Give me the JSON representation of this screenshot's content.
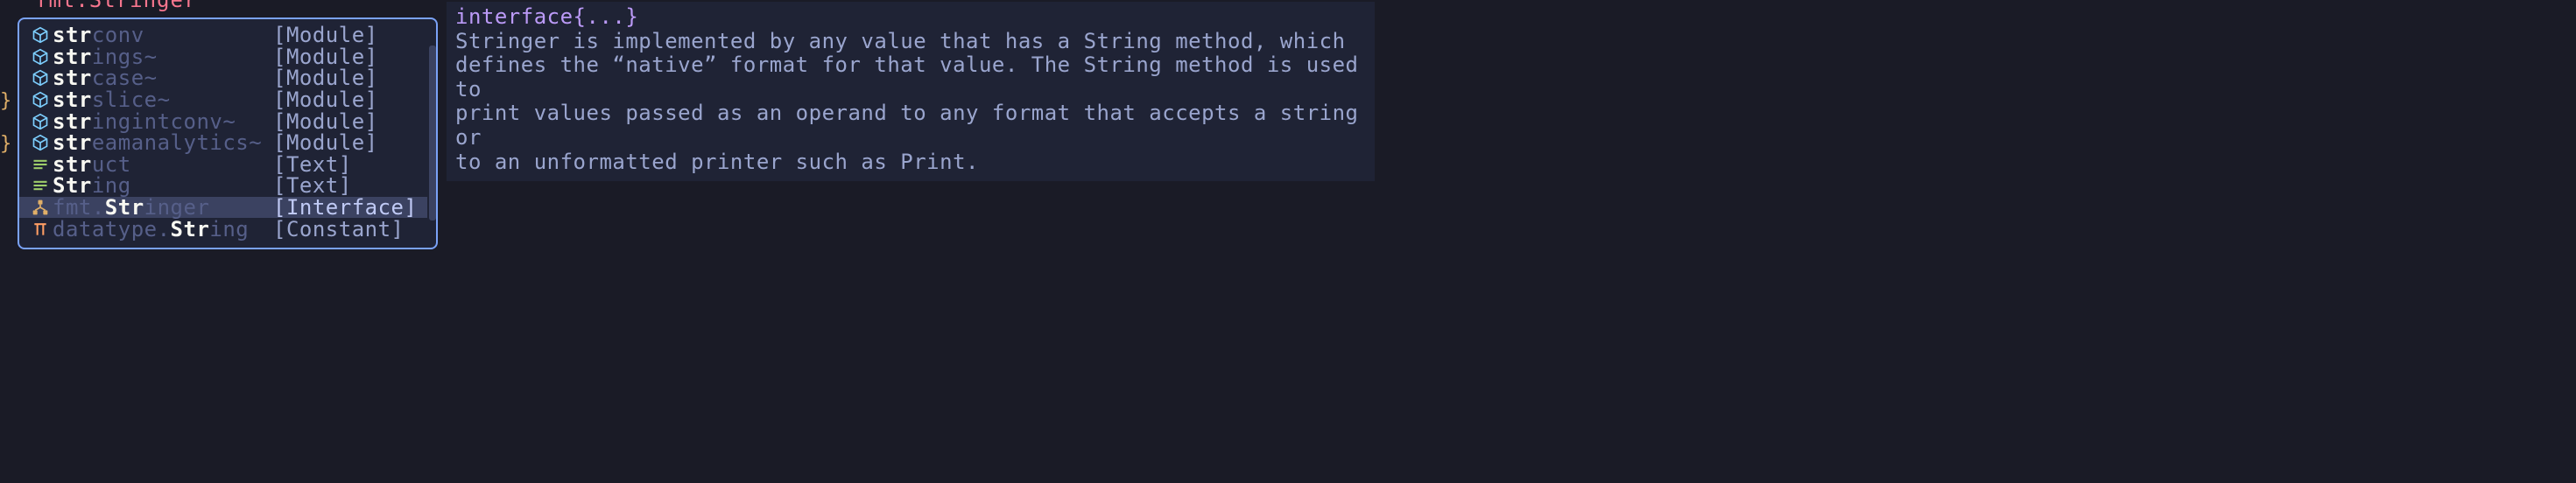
{
  "colors": {
    "bg": "#1a1b26",
    "popup_bg": "#1f2335",
    "popup_border": "#7aa2f7",
    "selected_bg": "#3b4261",
    "highlight": "#f8f8f2",
    "dim": "#565f89",
    "kind": "#9aa5ce",
    "signature": "#bb9af7",
    "doc_text": "#9aa5ce",
    "icon_module": "#7dcfff",
    "icon_text": "#9ece6a",
    "icon_interface": "#e0af68",
    "icon_constant": "#ff9e64"
  },
  "top_fragment": "fmt.Stringer",
  "completion": {
    "selected_index": 8,
    "items": [
      {
        "icon": "module",
        "pkg": "",
        "match": "str",
        "rest": "conv",
        "tilde": false,
        "kind": "[Module]"
      },
      {
        "icon": "module",
        "pkg": "",
        "match": "str",
        "rest": "ings",
        "tilde": true,
        "kind": "[Module]"
      },
      {
        "icon": "module",
        "pkg": "",
        "match": "str",
        "rest": "case",
        "tilde": true,
        "kind": "[Module]"
      },
      {
        "icon": "module",
        "pkg": "",
        "match": "str",
        "rest": "slice",
        "tilde": true,
        "kind": "[Module]"
      },
      {
        "icon": "module",
        "pkg": "",
        "match": "str",
        "rest": "ingintconv",
        "tilde": true,
        "kind": "[Module]"
      },
      {
        "icon": "module",
        "pkg": "",
        "match": "str",
        "rest": "eamanalytics",
        "tilde": true,
        "kind": "[Module]"
      },
      {
        "icon": "text",
        "pkg": "",
        "match": "str",
        "rest": "uct",
        "tilde": false,
        "kind": "[Text]"
      },
      {
        "icon": "text",
        "pkg": "",
        "match": "Str",
        "rest": "ing",
        "tilde": false,
        "kind": "[Text]"
      },
      {
        "icon": "interface",
        "pkg": "fmt.",
        "match": "Str",
        "rest": "inger",
        "tilde": false,
        "kind": "[Interface]"
      },
      {
        "icon": "constant",
        "pkg": "datatype.",
        "match": "Str",
        "rest": "ing",
        "tilde": false,
        "kind": "[Constant]"
      }
    ]
  },
  "doc": {
    "signature": "interface{...}",
    "body": "Stringer is implemented by any value that has a String method, which\ndefines the “native” format for that value. The String method is used to\nprint values passed as an operand to any format that accepts a string or\nto an unformatted printer such as Print."
  }
}
